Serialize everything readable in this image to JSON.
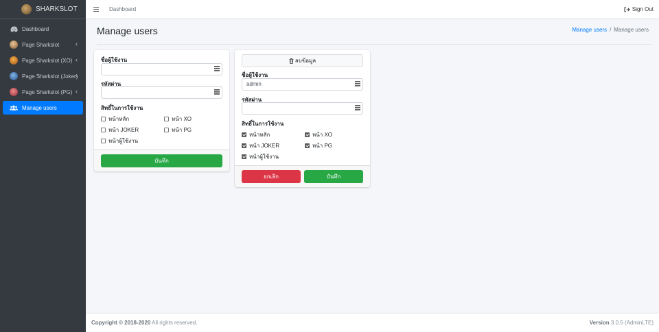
{
  "brand": {
    "name": "SHARKSLOT"
  },
  "sidebar": {
    "items": [
      {
        "label": "Dashboard"
      },
      {
        "label": "Page Sharkslot"
      },
      {
        "label": "Page Sharkslot (XO)"
      },
      {
        "label": "Page Sharkslot (Joker)"
      },
      {
        "label": "Page Sharkslot (PG)"
      },
      {
        "label": "Manage users"
      }
    ]
  },
  "topbar": {
    "link": "Dashboard",
    "signout": "Sign Out"
  },
  "header": {
    "title": "Manage users",
    "breadcrumb": {
      "link": "Manage users",
      "current": "Manage users"
    }
  },
  "form_new": {
    "username_label": "ชื่อผู้ใช้งาน",
    "username_value": "",
    "password_label": "รหัสผ่าน",
    "password_value": "",
    "perm_label": "สิทธิ์ในการใช้งาน",
    "perms": [
      {
        "label": "หน้าหลัก",
        "checked": false
      },
      {
        "label": "หน้า XO",
        "checked": false
      },
      {
        "label": "หน้า JOKER",
        "checked": false
      },
      {
        "label": "หน้า PG",
        "checked": false
      },
      {
        "label": "หน้าผู้ใช้งาน",
        "checked": false
      }
    ],
    "save_label": "บันทึก"
  },
  "form_edit": {
    "delete_label": "ลบข้อมูล",
    "username_label": "ชื่อผู้ใช้งาน",
    "username_value": "admin",
    "password_label": "รหัสผ่าน",
    "password_value": "",
    "perm_label": "สิทธิ์ในการใช้งาน",
    "perms": [
      {
        "label": "หน้าหลัก",
        "checked": true
      },
      {
        "label": "หน้า XO",
        "checked": true
      },
      {
        "label": "หน้า JOKER",
        "checked": true
      },
      {
        "label": "หน้า PG",
        "checked": true
      },
      {
        "label": "หน้าผู้ใช้งาน",
        "checked": true
      }
    ],
    "cancel_label": "ยกเลิก",
    "save_label": "บันทึก"
  },
  "footer": {
    "copyright": "Copyright © 2018-2020",
    "rights": " All rights reserved.",
    "version_label": "Version",
    "version_value": " 3.0.5 (AdminLTE)"
  },
  "colors": {
    "primary": "#007bff",
    "success": "#28a745",
    "danger": "#dc3545",
    "sidebar": "#343a40"
  }
}
